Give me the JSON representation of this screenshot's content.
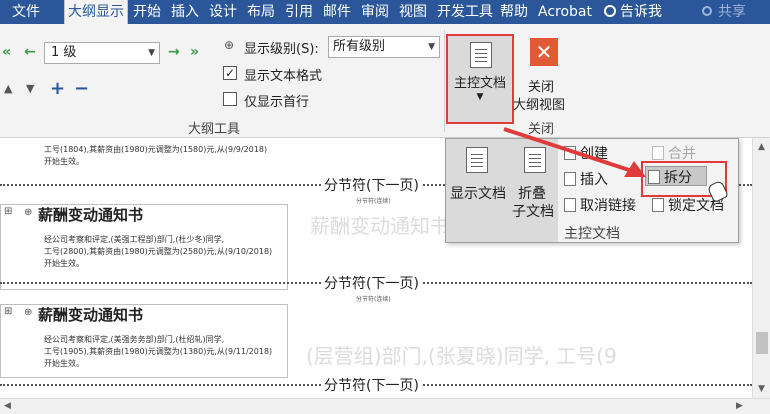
{
  "tabs": [
    {
      "label": "文件",
      "active": false
    },
    {
      "label": "大纲显示",
      "active": true
    },
    {
      "label": "开始",
      "active": false
    },
    {
      "label": "插入",
      "active": false
    },
    {
      "label": "设计",
      "active": false
    },
    {
      "label": "布局",
      "active": false
    },
    {
      "label": "引用",
      "active": false
    },
    {
      "label": "邮件",
      "active": false
    },
    {
      "label": "审阅",
      "active": false
    },
    {
      "label": "视图",
      "active": false
    },
    {
      "label": "开发工具",
      "active": false
    },
    {
      "label": "帮助",
      "active": false
    },
    {
      "label": "Acrobat",
      "active": false
    }
  ],
  "tell_me": "告诉我",
  "share": "共享",
  "outline_tools": {
    "level_value": "1 级",
    "show_level_label": "显示级别(S):",
    "show_level_value": "所有级别",
    "show_text_format_label": "显示文本格式",
    "show_text_format_checked": true,
    "first_line_only_label": "仅显示首行",
    "first_line_only_checked": false,
    "group_label": "大纲工具"
  },
  "master": {
    "button_label": "主控文档",
    "close_line1": "关闭",
    "close_line2": "大纲视图",
    "close_group_label": "关闭"
  },
  "panel": {
    "show_doc": "显示文档",
    "collapse_line1": "折叠",
    "collapse_line2": "子文档",
    "create": "创建",
    "insert": "插入",
    "unlink": "取消链接",
    "merge": "合并",
    "split": "拆分",
    "lock": "锁定文档",
    "group_label": "主控文档"
  },
  "document": {
    "line_1": "工号(1804),其薪资由(1980)元调整为(1580)元,从(9/9/2018)",
    "line_2": "开始生效。",
    "section_break": "分节符(下一页)",
    "section_break_small": "分节符(连续)",
    "heading": "薪酬变动通知书",
    "block2_line1": "经公司考察和评定,(美强工程部)部门,(杜少冬)同学,",
    "block2_line2": "工号(2800),其薪资由(1980)元调整为(2580)元,从(9/10/2018)",
    "block2_line3": "开始生效。",
    "block3_line1": "经公司考察和评定,(美强务务部)部门,(杜绍轧)同学,",
    "block3_line2": "工号(1905),其薪资由(1980)元调整为(1380)元,从(9/11/2018)",
    "block3_line3": "开始生效。",
    "watermark_1": "薪酬变动通知书",
    "watermark_2": "(层营组)部门,(张夏晓)同学, 工号(9"
  }
}
